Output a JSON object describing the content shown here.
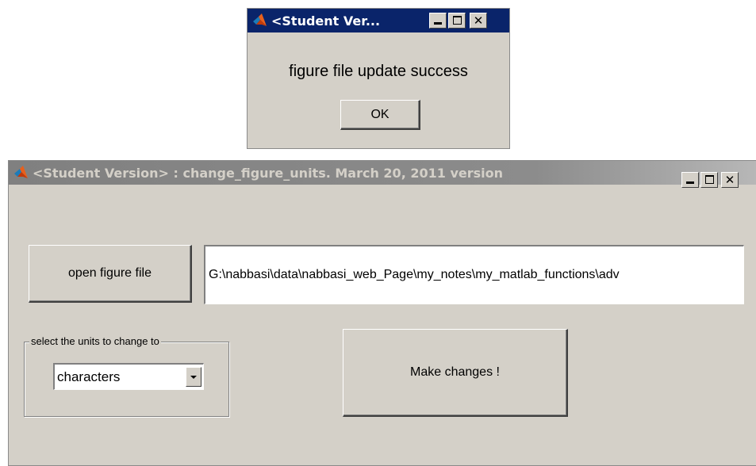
{
  "dialog": {
    "title": "<Student Ver...",
    "message": "figure file update success",
    "ok_label": "OK",
    "titlebar_color": "#0a246a"
  },
  "main_window": {
    "title": "<Student Version> : change_figure_units. March 20, 2011 version",
    "titlebar_color": "#808080",
    "open_button_label": "open figure file",
    "file_path": "G:\\nabbasi\\data\\nabbasi_web_Page\\my_notes\\my_matlab_functions\\adv",
    "units_group_label": "select the units to change to",
    "units_selected": "characters",
    "make_changes_label": "Make changes !"
  },
  "icons": {
    "app": "matlab-logo-icon",
    "minimize": "minimize-icon",
    "maximize": "maximize-icon",
    "close": "close-icon",
    "dropdown": "chevron-down-icon"
  },
  "colors": {
    "window_bg": "#d4d0c8",
    "active_title_text": "#ffffff",
    "inactive_title_text": "#d4d0c8"
  }
}
